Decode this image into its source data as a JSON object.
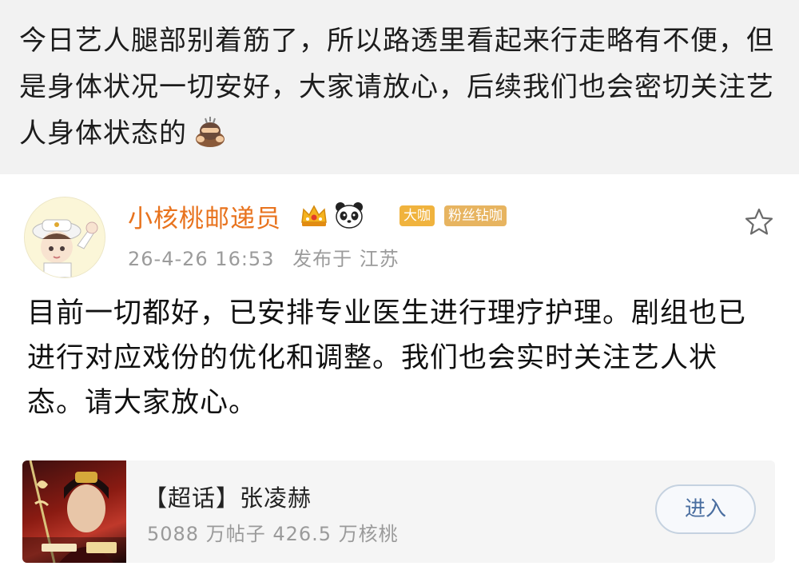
{
  "quoted_post": {
    "text": "今日艺人腿部别着筋了，所以路透里看起来行走略有不便，但是身体状况一切安好，大家请放心，后续我们也会密切关注艺人身体状态的"
  },
  "author": {
    "name": "小核桃邮递员",
    "badges": [
      "大咖",
      "粉丝钻咖"
    ],
    "timestamp": "26-4-26 16:53",
    "location": "发布于 江苏"
  },
  "post": {
    "text": "目前一切都好，已安排专业医生进行理疗护理。剧组也已进行对应戏份的优化和调整。我们也会实时关注艺人状态。请大家放心。"
  },
  "topic_card": {
    "title": "【超话】张凌赫",
    "stats": "5088 万帖子  426.5 万核桃",
    "button_label": "进入"
  },
  "colors": {
    "username": "#e8731e",
    "badge_big": "#f0b33e",
    "badge_fan": "#e7b460",
    "button_text": "#4a6ea0"
  },
  "icons": [
    "bow-emoji-icon",
    "crown-icon",
    "panda-icon",
    "star-icon",
    "avatar"
  ]
}
